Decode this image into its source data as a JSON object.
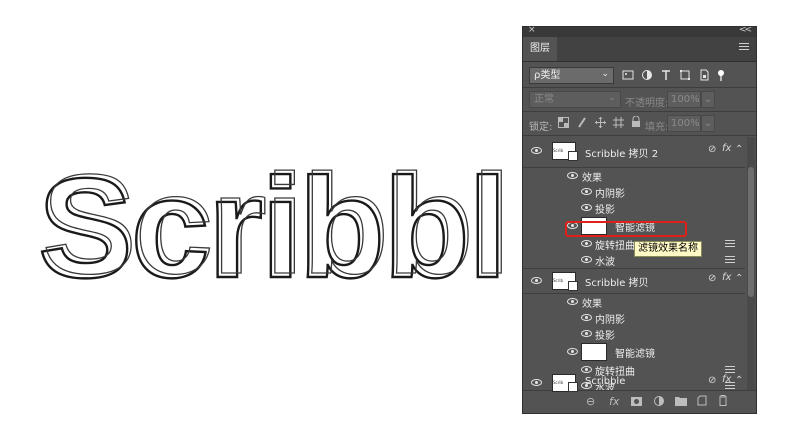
{
  "canvas": {
    "text": "Scribbl"
  },
  "panel": {
    "close_glyph": "×",
    "collapse_glyph": "<<",
    "tab_label": "图层",
    "filter": {
      "label": "ρ类型",
      "chevron": "⌄"
    },
    "filter_icons": [
      "image-filter-icon",
      "adjustment-filter-icon",
      "type-filter-icon",
      "shape-filter-icon",
      "smart-object-filter-icon",
      "toggle-filter-icon"
    ],
    "blend_mode": "正常",
    "opacity": {
      "label": "不透明度:",
      "value": "100%"
    },
    "lock": {
      "label": "锁定:"
    },
    "fill": {
      "label": "填充:",
      "value": "100%"
    },
    "layers": [
      {
        "kind": "layer",
        "name": "Scribble 拷贝 2",
        "fx": "fx"
      },
      {
        "kind": "effects",
        "name": "效果"
      },
      {
        "kind": "effect",
        "name": "内阴影"
      },
      {
        "kind": "effect",
        "name": "投影"
      },
      {
        "kind": "smart-filters",
        "name": "智能滤镜"
      },
      {
        "kind": "filter",
        "name": "旋转扭曲"
      },
      {
        "kind": "filter",
        "name": "水波"
      },
      {
        "kind": "layer",
        "name": "Scribble 拷贝",
        "fx": "fx"
      },
      {
        "kind": "effects",
        "name": "效果"
      },
      {
        "kind": "effect",
        "name": "内阴影"
      },
      {
        "kind": "effect",
        "name": "投影"
      },
      {
        "kind": "smart-filters",
        "name": "智能滤镜"
      },
      {
        "kind": "filter",
        "name": "旋转扭曲"
      },
      {
        "kind": "filter",
        "name": "水波"
      },
      {
        "kind": "layer",
        "name": "Scribble",
        "fx": "fx"
      }
    ]
  },
  "tooltip": {
    "text": "滤镜效果名称"
  },
  "colors": {
    "panel": "#535353",
    "highlight": "#e0201a",
    "tooltip": "#fff9c6"
  }
}
